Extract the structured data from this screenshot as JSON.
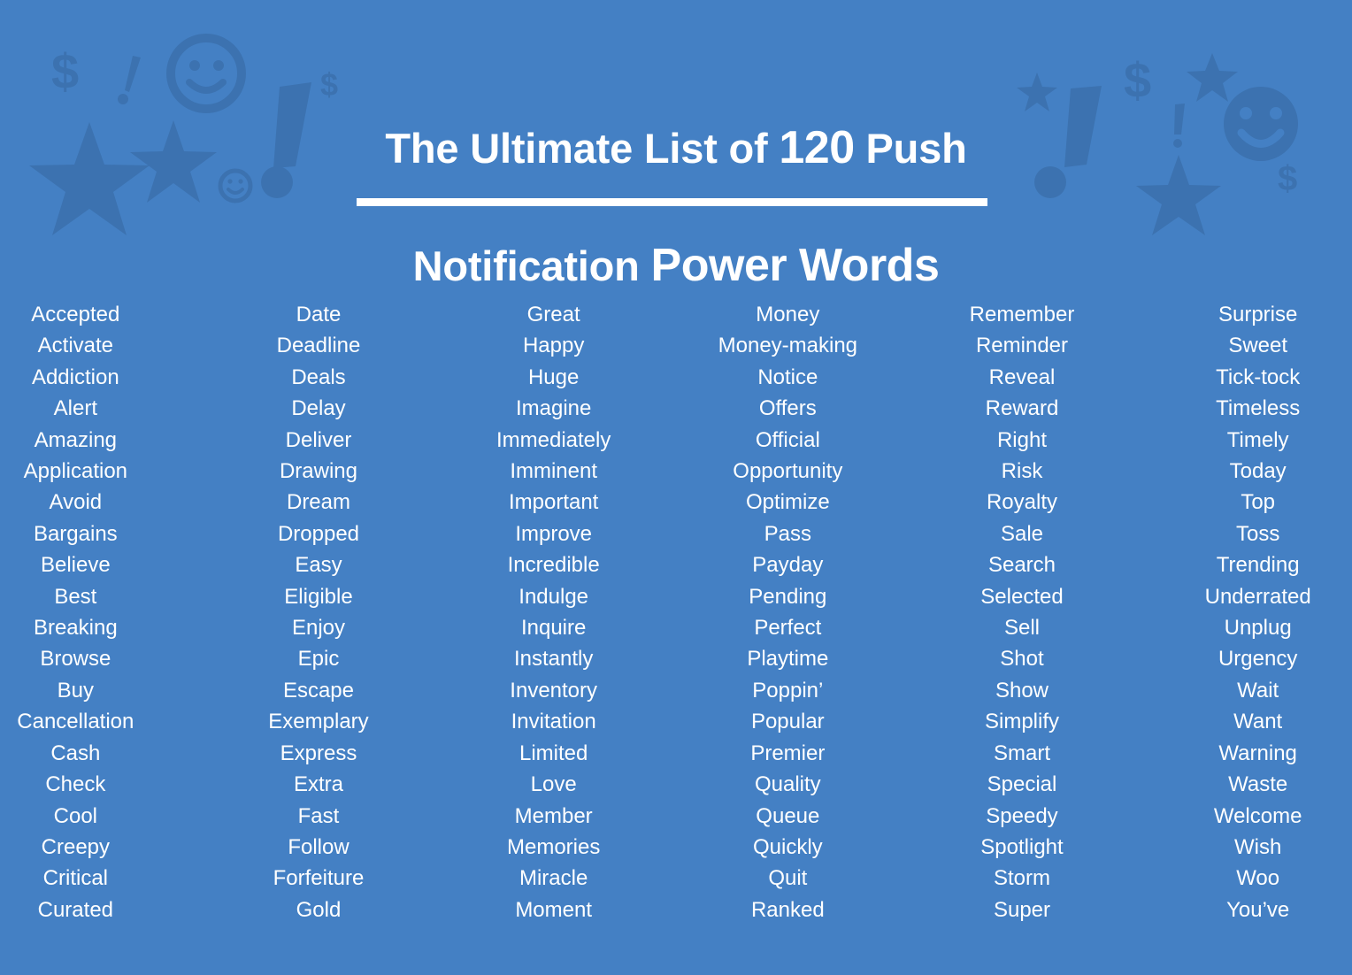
{
  "page": {
    "background_color": "#4480c4",
    "text_color": "#ffffff",
    "decor_color": "#3c72b0"
  },
  "header": {
    "title_full": "The Ultimate List of 120 Push Notification Power Words",
    "line1_regular": "The Ultimate List of ",
    "line1_strong": "120",
    "line1_tail": " Push",
    "line2_regular": "Notification ",
    "line2_strong": "Power Words",
    "count": "120",
    "divider": "title-underline-bar",
    "decorations": [
      "dollar-sign-icon",
      "exclamation-mark-icon",
      "smiley-face-icon",
      "star-icon",
      "dot-icon"
    ]
  },
  "word_list": {
    "total": 120,
    "columns": [
      {
        "index": 1,
        "words": [
          "Accepted",
          "Activate",
          "Addiction",
          "Alert",
          "Amazing",
          "Application",
          "Avoid",
          "Bargains",
          "Believe",
          "Best",
          "Breaking",
          "Browse",
          "Buy",
          "Cancellation",
          "Cash",
          "Check",
          "Cool",
          "Creepy",
          "Critical",
          "Curated"
        ]
      },
      {
        "index": 2,
        "words": [
          "Date",
          "Deadline",
          "Deals",
          "Delay",
          "Deliver",
          "Drawing",
          "Dream",
          "Dropped",
          "Easy",
          "Eligible",
          "Enjoy",
          "Epic",
          "Escape",
          "Exemplary",
          "Express",
          "Extra",
          "Fast",
          "Follow",
          "Forfeiture",
          "Gold"
        ]
      },
      {
        "index": 3,
        "words": [
          "Great",
          "Happy",
          "Huge",
          "Imagine",
          "Immediately",
          "Imminent",
          "Important",
          "Improve",
          "Incredible",
          "Indulge",
          "Inquire",
          "Instantly",
          "Inventory",
          "Invitation",
          "Limited",
          "Love",
          "Member",
          "Memories",
          "Miracle",
          "Moment"
        ]
      },
      {
        "index": 4,
        "words": [
          "Money",
          "Money-making",
          "Notice",
          "Offers",
          "Official",
          "Opportunity",
          "Optimize",
          "Pass",
          "Payday",
          "Pending",
          "Perfect",
          "Playtime",
          "Poppin’",
          "Popular",
          "Premier",
          "Quality",
          "Queue",
          "Quickly",
          "Quit",
          "Ranked"
        ]
      },
      {
        "index": 5,
        "words": [
          "Remember",
          "Reminder",
          "Reveal",
          "Reward",
          "Right",
          "Risk",
          "Royalty",
          "Sale",
          "Search",
          "Selected",
          "Sell",
          "Shot",
          "Show",
          "Simplify",
          "Smart",
          "Special",
          "Speedy",
          "Spotlight",
          "Storm",
          "Super"
        ]
      },
      {
        "index": 6,
        "words": [
          "Surprise",
          "Sweet",
          "Tick-tock",
          "Timeless",
          "Timely",
          "Today",
          "Top",
          "Toss",
          "Trending",
          "Underrated",
          "Unplug",
          "Urgency",
          "Wait",
          "Want",
          "Warning",
          "Waste",
          "Welcome",
          "Wish",
          "Woo",
          "You’ve"
        ]
      }
    ]
  }
}
